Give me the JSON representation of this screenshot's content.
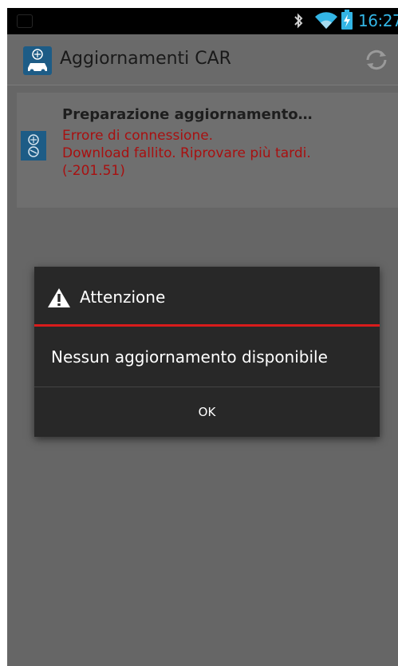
{
  "status_bar": {
    "time": "16:27",
    "icons": [
      "notification-icon",
      "bluetooth-icon",
      "wifi-icon",
      "battery-charging-icon"
    ],
    "accent_color": "#33b5e5"
  },
  "action_bar": {
    "title": "Aggiornamenti CAR",
    "app_icon": "car-update-app-icon",
    "action_icon": "sync-icon"
  },
  "update_card": {
    "icon": "car-update-icon",
    "title": "Preparazione aggiornamento…",
    "error_lines": [
      "Errore di connessione.",
      "Download fallito. Riprovare più tardi.",
      "(-201.51)"
    ],
    "error_color": "#a81010"
  },
  "dialog": {
    "icon": "warning-icon",
    "title": "Attenzione",
    "message": "Nessun aggiornamento disponibile",
    "ok_label": "OK",
    "divider_color": "#d81c1c"
  }
}
